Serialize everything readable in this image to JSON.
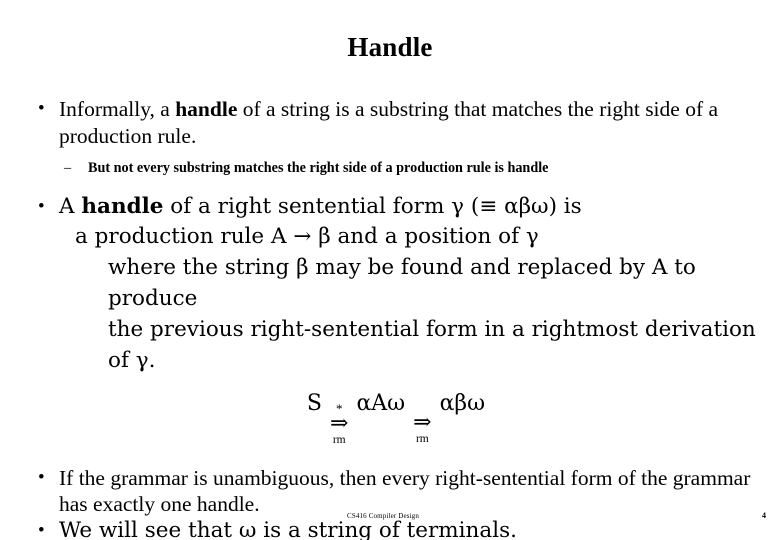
{
  "slide": {
    "title": "Handle",
    "bullets": {
      "b1_marker": "•",
      "b1_pre": "Informally, a ",
      "b1_bold": "handle",
      "b1_post": " of a string is a substring that matches the right side of a production rule.",
      "sub_marker": "–",
      "sub_text": "But not every substring matches the right side of a production rule is handle",
      "b2_marker": "•",
      "b2_pre": "A ",
      "b2_bold": "handle",
      "b2_post": " of a right sentential form  γ (≡ αβω)  is",
      "b2_line2": "a production rule A → β and a position of γ",
      "b2_line3": "where the string β may be found and replaced by A to produce",
      "b2_line4": "the previous right-sentential form in  a rightmost derivation of γ.",
      "b3_marker": "•",
      "b3_text": "If the grammar is unambiguous, then every right-sentential form of the grammar has exactly one handle.",
      "b4_marker": "•",
      "b4_text": "We will see that ω is a string of terminals."
    },
    "derivation": {
      "start": "S",
      "arrow1_sup": "*",
      "arrow1": "⇒",
      "arrow1_sub": "rm",
      "middle": "αAω",
      "arrow2_sup": "",
      "arrow2": "⇒",
      "arrow2_sub": "rm",
      "end": "αβω"
    },
    "footer": {
      "course": "CS416 Compiler Design",
      "page": "4"
    }
  }
}
